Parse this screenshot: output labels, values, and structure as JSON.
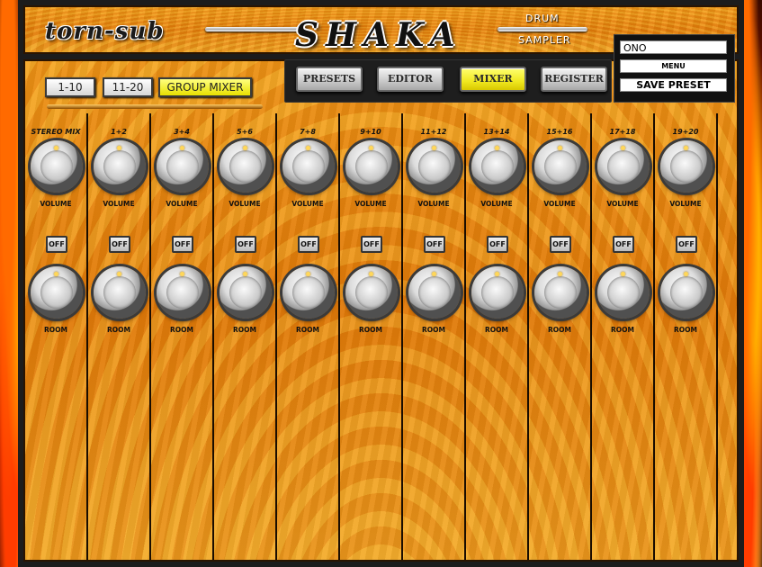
{
  "header": {
    "brand": "torn-sub",
    "logo": "SHAKA",
    "logo_sub_top": "DRUM",
    "logo_sub_bottom": "SAMPLER"
  },
  "right_panel": {
    "preset_name": "ONO",
    "menu_label": "MENU",
    "save_label": "SAVE PRESET"
  },
  "tabs": [
    {
      "label": "PRESETS",
      "active": false
    },
    {
      "label": "EDITOR",
      "active": false
    },
    {
      "label": "MIXER",
      "active": true
    },
    {
      "label": "REGISTER",
      "active": false
    }
  ],
  "page_buttons": [
    {
      "label": "1-10",
      "active": false
    },
    {
      "label": "11-20",
      "active": false
    },
    {
      "label": "GROUP MIXER",
      "active": true
    }
  ],
  "knob_labels": {
    "volume": "VOLUME",
    "room": "ROOM",
    "off": "OFF"
  },
  "channels": [
    {
      "name": "STEREO MIX"
    },
    {
      "name": "1+2"
    },
    {
      "name": "3+4"
    },
    {
      "name": "5+6"
    },
    {
      "name": "7+8"
    },
    {
      "name": "9+10"
    },
    {
      "name": "11+12"
    },
    {
      "name": "13+14"
    },
    {
      "name": "15+16"
    },
    {
      "name": "17+18"
    },
    {
      "name": "19+20"
    }
  ],
  "colors": {
    "panel_orange": "#e98a12",
    "active_yellow": "#f0e820",
    "frame_dark": "#1c1c1c"
  }
}
